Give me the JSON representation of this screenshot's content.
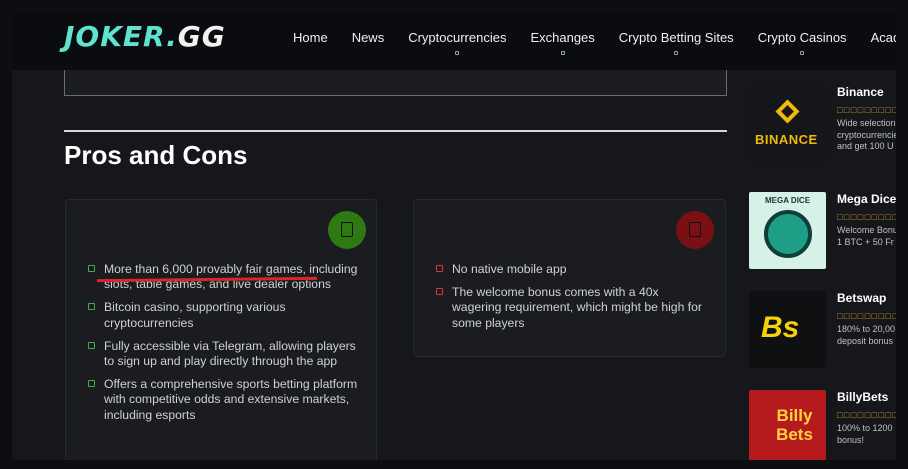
{
  "header": {
    "logo_main": "JOKER.",
    "logo_gg": "GG",
    "nav": [
      {
        "label": "Home",
        "has_dropdown": false
      },
      {
        "label": "News",
        "has_dropdown": false
      },
      {
        "label": "Cryptocurrencies",
        "has_dropdown": true
      },
      {
        "label": "Exchanges",
        "has_dropdown": true
      },
      {
        "label": "Crypto Betting Sites",
        "has_dropdown": true
      },
      {
        "label": "Crypto Casinos",
        "has_dropdown": true
      },
      {
        "label": "Academy",
        "has_dropdown": false
      }
    ]
  },
  "main": {
    "section_title": "Pros and Cons",
    "pros": {
      "items": [
        "More than 6,000 provably fair games, including slots, table games, and live dealer options",
        "Bitcoin casino, supporting various cryptocurrencies",
        "Fully accessible via Telegram, allowing players to sign up and play directly through the app",
        "Offers a comprehensive sports betting platform with competitive odds and extensive markets, including esports"
      ]
    },
    "cons": {
      "items": [
        "No native mobile app",
        "The welcome bonus comes with a 40x wagering requirement, which might be high for some players"
      ]
    }
  },
  "sidebar": {
    "items": [
      {
        "name": "Binance",
        "logo_text": "BINANCE",
        "stars": "□□□□□□□□□□",
        "desc": [
          "Wide selection",
          "cryptocurrencies",
          "and get 100 U"
        ]
      },
      {
        "name": "Mega Dice",
        "logo_text": "MEGA DICE",
        "stars": "□□□□□□□□□□",
        "desc": [
          "Welcome Bonu",
          "1 BTC + 50 Fr"
        ]
      },
      {
        "name": "Betswap",
        "logo_text": "Bs",
        "stars": "□□□□□□□□□□",
        "desc": [
          "180% to 20,00",
          "deposit bonus"
        ]
      },
      {
        "name": "BillyBets",
        "logo_text": "Billy Bets",
        "stars": "□□□□□□□□□□",
        "desc": [
          "100% to 1200",
          "bonus!"
        ]
      }
    ]
  },
  "colors": {
    "accent_teal": "#5fe3cf",
    "pros_green": "#2e7a12",
    "cons_red": "#7a1014",
    "star_gold": "#c99a2c",
    "annotation_red": "#d8262b"
  }
}
